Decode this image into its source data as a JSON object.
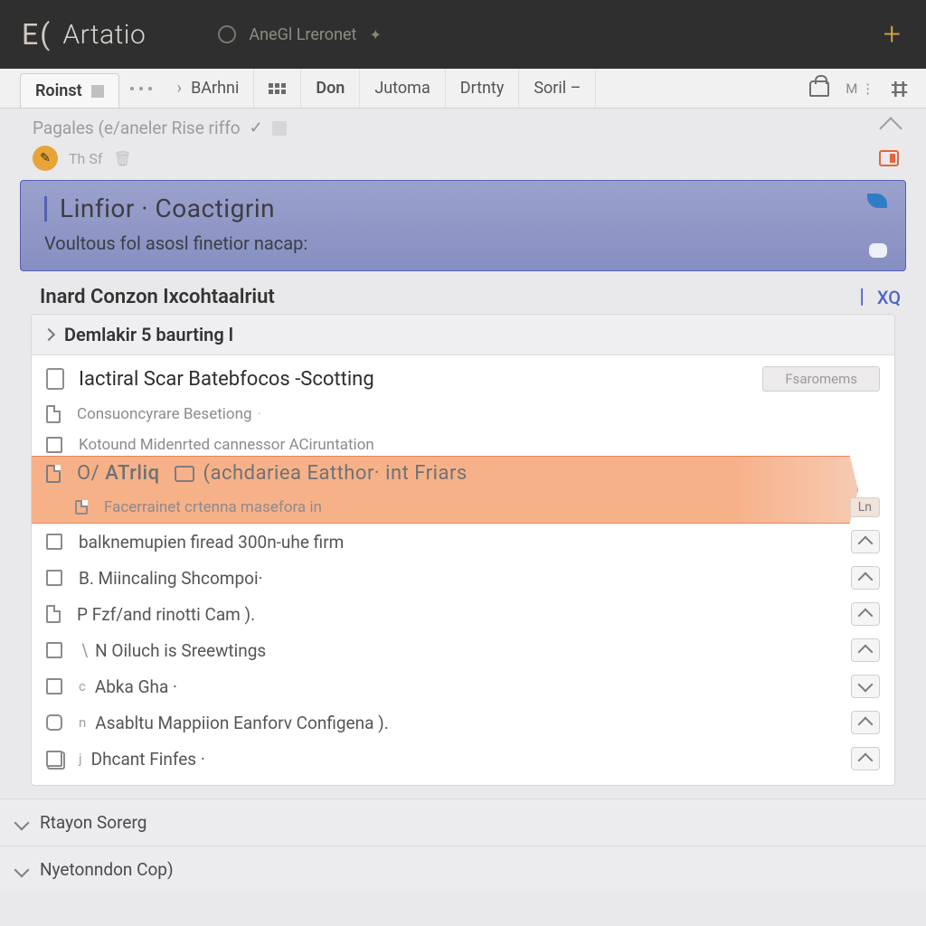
{
  "header": {
    "brand_prefix": "E",
    "brand_name": "Artatio",
    "center_text": "AneGl  Lreronet"
  },
  "tabs": {
    "first": "Roinst",
    "items": [
      "BArhni",
      "Don",
      "Jutoma",
      "Drtnty",
      "Soril –"
    ],
    "right_m": "M"
  },
  "crumb": {
    "text": "Pagales (e/aneler Rise riffo",
    "pill_text": "Th Sf"
  },
  "banner": {
    "title": "Linfior · Coactigrin",
    "subtitle": "Voultous fol asosl finetior nacap:"
  },
  "section": {
    "title": "Inard Conzon Ixcohtaalriut",
    "xq": "XQ"
  },
  "group": {
    "header": "Demlakir 5 baurting l",
    "title_row": "Iactiral Scar Batebfocos -Scotting",
    "title_btn": "Fsaromems",
    "rows": [
      {
        "text": "Consuoncyrare Besetiong",
        "icon": "doc",
        "muted": true,
        "up": false
      },
      {
        "text": "Kotound Midenrted cannessor ACiruntation",
        "icon": "box",
        "muted": true,
        "up": false
      }
    ],
    "hl": {
      "line1_pre": "O/",
      "line1_main": "ATrliq",
      "line1_rest": "(achdariea Eatthor·  int Friars",
      "line2": "Facerrainet crtenna masefora in",
      "ln_label": "Ln"
    },
    "rows2": [
      {
        "text": "balknemupien firead 300n-uhe firm",
        "icon": "box",
        "up": true,
        "gutter": "square"
      },
      {
        "text": "B. Miincaling Shcompoi·",
        "icon": "box",
        "up": true,
        "gutter": "dot"
      },
      {
        "text": "P  Fzf/and rinotti Cam ).",
        "icon": "doc",
        "up": true
      },
      {
        "text": "N Oiluch is Sreewtings",
        "icon": "box",
        "up": true
      },
      {
        "text": "Abka Gha ·",
        "icon": "box",
        "up": true,
        "pre": "c"
      },
      {
        "text": "Asabltu Mappiion Eanforv Configena ).",
        "icon": "box",
        "up": true,
        "pre": "n"
      },
      {
        "text": "Dhcant Finfes ·",
        "icon": "box-dbl",
        "up": true,
        "pre": "j"
      }
    ]
  },
  "footers": [
    "Rtayon Sorerg",
    "Nyetonndon Cop)"
  ]
}
